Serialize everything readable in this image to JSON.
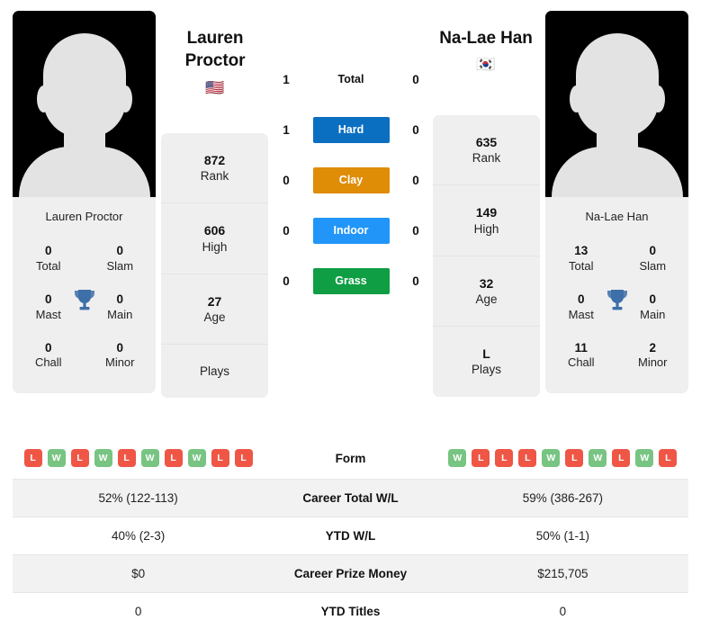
{
  "players": {
    "left": {
      "name": "Lauren Proctor",
      "name_line1": "Lauren",
      "name_line2": "Proctor",
      "flag": "🇺🇸",
      "flag_name": "flag-usa",
      "photo_caption": "Lauren Proctor",
      "titles": [
        {
          "value": "0",
          "label": "Total"
        },
        {
          "value": "0",
          "label": "Slam"
        },
        {
          "value": "0",
          "label": "Mast"
        },
        {
          "value": "0",
          "label": "Main"
        },
        {
          "value": "0",
          "label": "Chall"
        },
        {
          "value": "0",
          "label": "Minor"
        }
      ],
      "stats": [
        {
          "value": "872",
          "label": "Rank"
        },
        {
          "value": "606",
          "label": "High"
        },
        {
          "value": "27",
          "label": "Age"
        },
        {
          "value": "",
          "label": "Plays"
        }
      ],
      "form": [
        "L",
        "W",
        "L",
        "W",
        "L",
        "W",
        "L",
        "W",
        "L",
        "L"
      ],
      "career_total_wl": "52% (122-113)",
      "ytd_wl": "40% (2-3)",
      "career_prize_money": "$0",
      "ytd_titles": "0"
    },
    "right": {
      "name": "Na-Lae Han",
      "name_line1": "Na-Lae Han",
      "name_line2": "",
      "flag": "🇰🇷",
      "flag_name": "flag-south-korea",
      "photo_caption": "Na-Lae Han",
      "titles": [
        {
          "value": "13",
          "label": "Total"
        },
        {
          "value": "0",
          "label": "Slam"
        },
        {
          "value": "0",
          "label": "Mast"
        },
        {
          "value": "0",
          "label": "Main"
        },
        {
          "value": "11",
          "label": "Chall"
        },
        {
          "value": "2",
          "label": "Minor"
        }
      ],
      "stats": [
        {
          "value": "635",
          "label": "Rank"
        },
        {
          "value": "149",
          "label": "High"
        },
        {
          "value": "32",
          "label": "Age"
        },
        {
          "value": "L",
          "label": "Plays"
        }
      ],
      "form": [
        "W",
        "L",
        "L",
        "L",
        "W",
        "L",
        "W",
        "L",
        "W",
        "L"
      ],
      "career_total_wl": "59% (386-267)",
      "ytd_wl": "50% (1-1)",
      "career_prize_money": "$215,705",
      "ytd_titles": "0"
    }
  },
  "surfaces": [
    {
      "label": "Total",
      "left": "1",
      "right": "0",
      "color": "",
      "chip": false
    },
    {
      "label": "Hard",
      "left": "1",
      "right": "0",
      "color": "#0b6fc1",
      "chip": true
    },
    {
      "label": "Clay",
      "left": "0",
      "right": "0",
      "color": "#df8c07",
      "chip": true
    },
    {
      "label": "Indoor",
      "left": "0",
      "right": "0",
      "color": "#2196f8",
      "chip": true
    },
    {
      "label": "Grass",
      "left": "0",
      "right": "0",
      "color": "#0f9e44",
      "chip": true
    }
  ],
  "table_rows": [
    {
      "label": "Form",
      "type": "form"
    },
    {
      "label": "Career Total W/L",
      "type": "text",
      "key": "career_total_wl"
    },
    {
      "label": "YTD W/L",
      "type": "text",
      "key": "ytd_wl"
    },
    {
      "label": "Career Prize Money",
      "type": "text",
      "key": "career_prize_money"
    },
    {
      "label": "YTD Titles",
      "type": "text",
      "key": "ytd_titles"
    }
  ],
  "colors": {
    "hard": "#0b6fc1",
    "clay": "#df8c07",
    "indoor": "#2196f8",
    "grass": "#0f9e44",
    "win_badge": "#78c482",
    "loss_badge": "#ef5645",
    "trophy": "#3d6fa8",
    "card_bg": "#efefef",
    "row_shade": "#f2f2f2"
  },
  "icons": {
    "trophy": "trophy-icon"
  }
}
